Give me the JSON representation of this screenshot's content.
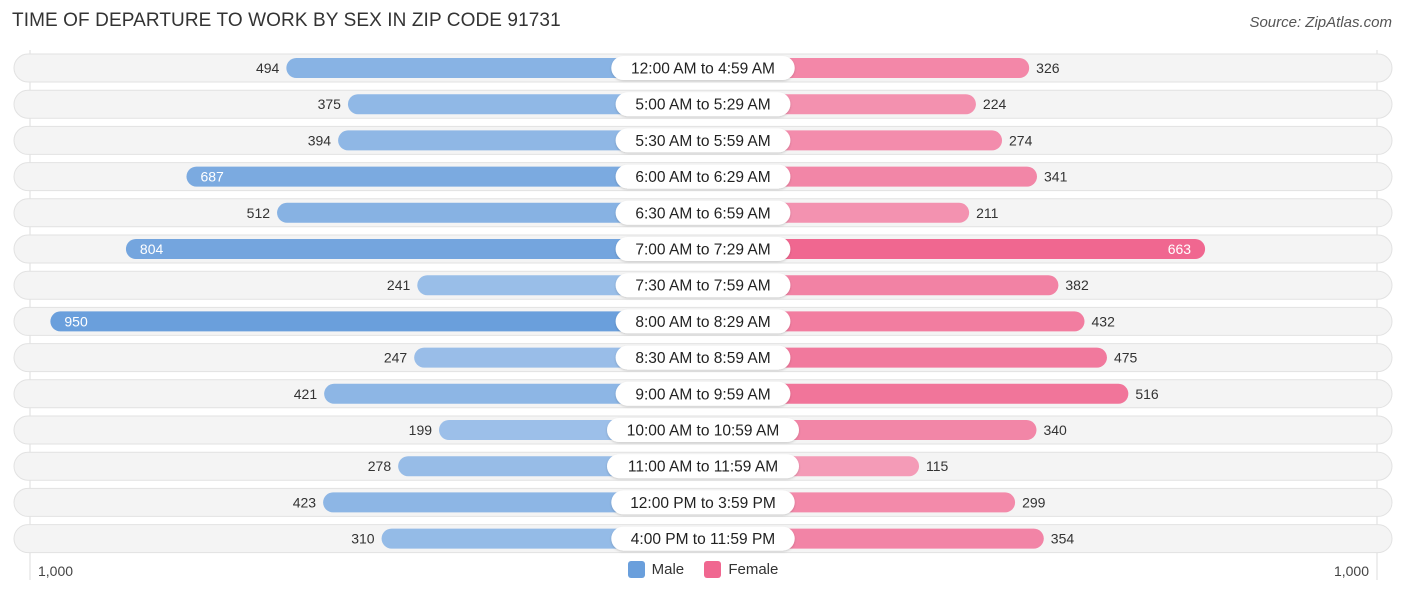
{
  "title": "TIME OF DEPARTURE TO WORK BY SEX IN ZIP CODE 91731",
  "source": "Source: ZipAtlas.com",
  "colors": {
    "male": "#6a9fdc",
    "male_light": "#a9c8ec",
    "female": "#f06790",
    "female_light": "#f5a6bf",
    "row_bg": "#f3f3f3"
  },
  "chart_data": {
    "type": "bar",
    "orientation": "horizontal-diverging",
    "title": "TIME OF DEPARTURE TO WORK BY SEX IN ZIP CODE 91731",
    "categories": [
      "12:00 AM to 4:59 AM",
      "5:00 AM to 5:29 AM",
      "5:30 AM to 5:59 AM",
      "6:00 AM to 6:29 AM",
      "6:30 AM to 6:59 AM",
      "7:00 AM to 7:29 AM",
      "7:30 AM to 7:59 AM",
      "8:00 AM to 8:29 AM",
      "8:30 AM to 8:59 AM",
      "9:00 AM to 9:59 AM",
      "10:00 AM to 10:59 AM",
      "11:00 AM to 11:59 AM",
      "12:00 PM to 3:59 PM",
      "4:00 PM to 11:59 PM"
    ],
    "series": [
      {
        "name": "Male",
        "values": [
          494,
          375,
          394,
          687,
          512,
          804,
          241,
          950,
          247,
          421,
          199,
          278,
          423,
          310
        ]
      },
      {
        "name": "Female",
        "values": [
          326,
          224,
          274,
          341,
          211,
          663,
          382,
          432,
          475,
          516,
          340,
          115,
          299,
          354
        ]
      }
    ],
    "axis": {
      "left_label": "1,000",
      "right_label": "1,000",
      "range": [
        0,
        1000
      ]
    },
    "legend": {
      "position": "bottom-center",
      "entries": [
        "Male",
        "Female"
      ]
    }
  }
}
